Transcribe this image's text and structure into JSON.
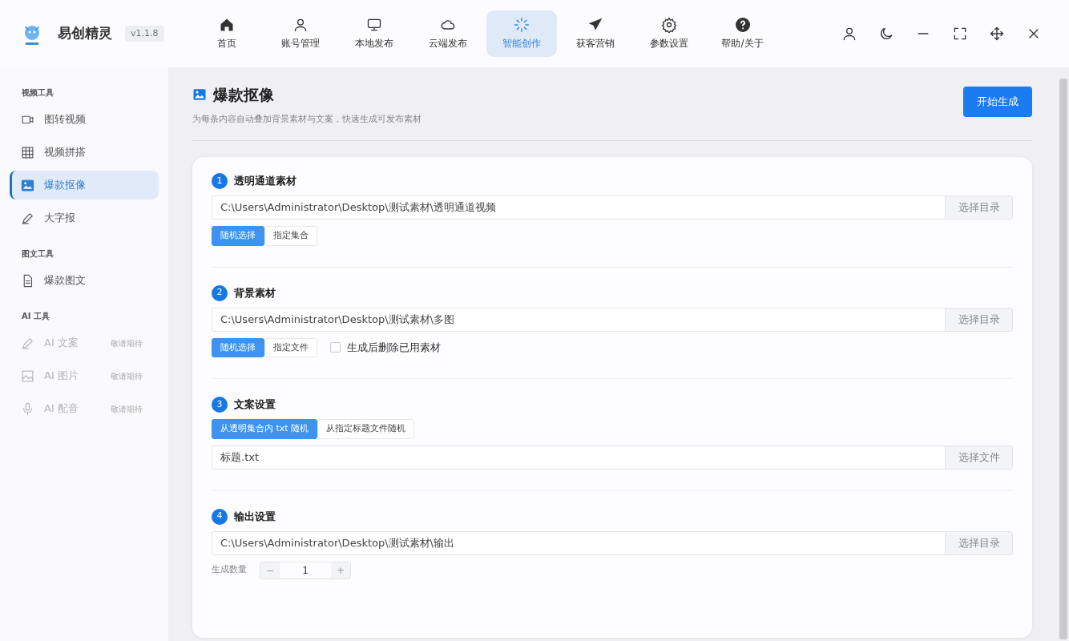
{
  "app": {
    "name": "易创精灵",
    "version": "v1.1.8"
  },
  "nav": [
    {
      "label": "首页",
      "selected": false
    },
    {
      "label": "账号管理",
      "selected": false
    },
    {
      "label": "本地发布",
      "selected": false
    },
    {
      "label": "云端发布",
      "selected": false
    },
    {
      "label": "智能创作",
      "selected": true
    },
    {
      "label": "获客营销",
      "selected": false
    },
    {
      "label": "参数设置",
      "selected": false
    },
    {
      "label": "帮助/关于",
      "selected": false
    }
  ],
  "sidebar": {
    "groups": [
      {
        "title": "视频工具",
        "items": [
          {
            "label": "图转视频",
            "selected": false,
            "disabled": false
          },
          {
            "label": "视频拼搭",
            "selected": false,
            "disabled": false
          },
          {
            "label": "爆款抠像",
            "selected": true,
            "disabled": false
          },
          {
            "label": "大字报",
            "selected": false,
            "disabled": false
          }
        ]
      },
      {
        "title": "图文工具",
        "items": [
          {
            "label": "爆款图文",
            "selected": false,
            "disabled": false
          }
        ]
      },
      {
        "title": "AI 工具",
        "items": [
          {
            "label": "AI 文案",
            "selected": false,
            "disabled": true,
            "badge": "敬请期待"
          },
          {
            "label": "AI 图片",
            "selected": false,
            "disabled": true,
            "badge": "敬请期待"
          },
          {
            "label": "AI 配音",
            "selected": false,
            "disabled": true,
            "badge": "敬请期待"
          }
        ]
      }
    ]
  },
  "page": {
    "title": "爆款抠像",
    "subtitle": "为每条内容自动叠加背景素材与文案，快速生成可发布素材",
    "action_button": "开始生成"
  },
  "sections": [
    {
      "number": "1",
      "title": "透明通道素材",
      "rows": [
        {
          "kind": "path",
          "value": "C:\\Users\\Administrator\\Desktop\\测试素材\\透明通道视频",
          "button": "选择目录"
        },
        {
          "kind": "segments",
          "options": [
            {
              "label": "随机选择",
              "selected": true
            },
            {
              "label": "指定集合",
              "selected": false
            }
          ]
        }
      ]
    },
    {
      "number": "2",
      "title": "背景素材",
      "rows": [
        {
          "kind": "path",
          "value": "C:\\Users\\Administrator\\Desktop\\测试素材\\多图",
          "button": "选择目录"
        },
        {
          "kind": "segments",
          "options": [
            {
              "label": "随机选择",
              "selected": true
            },
            {
              "label": "指定文件",
              "selected": false
            }
          ],
          "checkbox": {
            "label": "生成后删除已用素材",
            "checked": false
          }
        }
      ]
    },
    {
      "number": "3",
      "title": "文案设置",
      "rows": [
        {
          "kind": "segments",
          "options": [
            {
              "label": "从透明集合内 txt 随机",
              "selected": true
            },
            {
              "label": "从指定标题文件随机",
              "selected": false
            }
          ]
        },
        {
          "kind": "path",
          "value": "标题.txt",
          "button": "选择文件"
        }
      ]
    },
    {
      "number": "4",
      "title": "输出设置",
      "rows": [
        {
          "kind": "path",
          "value": "C:\\Users\\Administrator\\Desktop\\测试素材\\输出",
          "button": "选择目录"
        },
        {
          "kind": "counter",
          "label": "生成数量",
          "value": "1",
          "minus": "−",
          "plus": "+"
        }
      ]
    }
  ]
}
